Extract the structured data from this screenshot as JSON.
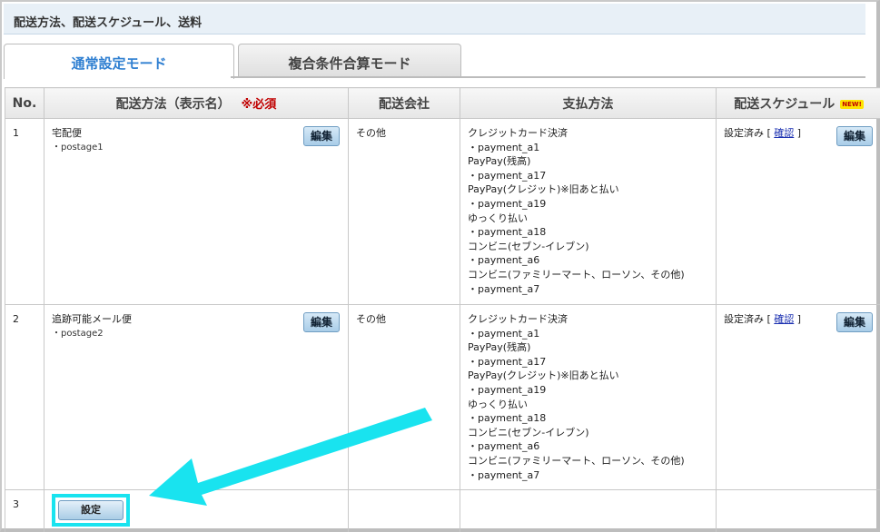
{
  "section_title": "配送方法、配送スケジュール、送料",
  "tabs": {
    "normal": "通常設定モード",
    "combined": "複合条件合算モード"
  },
  "columns": {
    "no": "No.",
    "method": "配送方法（表示名）",
    "required": "※必須",
    "company": "配送会社",
    "payment": "支払方法",
    "schedule": "配送スケジュール",
    "new_badge": "NEW!"
  },
  "rows": [
    {
      "no": "1",
      "name": "宅配便",
      "code": "・postage1",
      "edit_label": "編集",
      "company": "その他",
      "payments": [
        "クレジットカード決済",
        "・payment_a1",
        "PayPay(残高)",
        "・payment_a17",
        "PayPay(クレジット)※旧あと払い",
        "・payment_a19",
        "ゆっくり払い",
        "・payment_a18",
        "コンビニ(セブン-イレブン)",
        "・payment_a6",
        "コンビニ(ファミリーマート、ローソン、その他)",
        "・payment_a7"
      ],
      "schedule_prefix": "設定済み [ ",
      "schedule_link": "確認",
      "schedule_suffix": " ]",
      "schedule_edit_label": "編集"
    },
    {
      "no": "2",
      "name": "追跡可能メール便",
      "code": "・postage2",
      "edit_label": "編集",
      "company": "その他",
      "payments": [
        "クレジットカード決済",
        "・payment_a1",
        "PayPay(残高)",
        "・payment_a17",
        "PayPay(クレジット)※旧あと払い",
        "・payment_a19",
        "ゆっくり払い",
        "・payment_a18",
        "コンビニ(セブン-イレブン)",
        "・payment_a6",
        "コンビニ(ファミリーマート、ローソン、その他)",
        "・payment_a7"
      ],
      "schedule_prefix": "設定済み [ ",
      "schedule_link": "確認",
      "schedule_suffix": " ]",
      "schedule_edit_label": "編集"
    }
  ],
  "row3": {
    "no": "3",
    "setting_label": "設定"
  },
  "colors": {
    "active_tab": "#2f7fd1",
    "required": "#c00000",
    "highlight": "#19e3ef"
  }
}
